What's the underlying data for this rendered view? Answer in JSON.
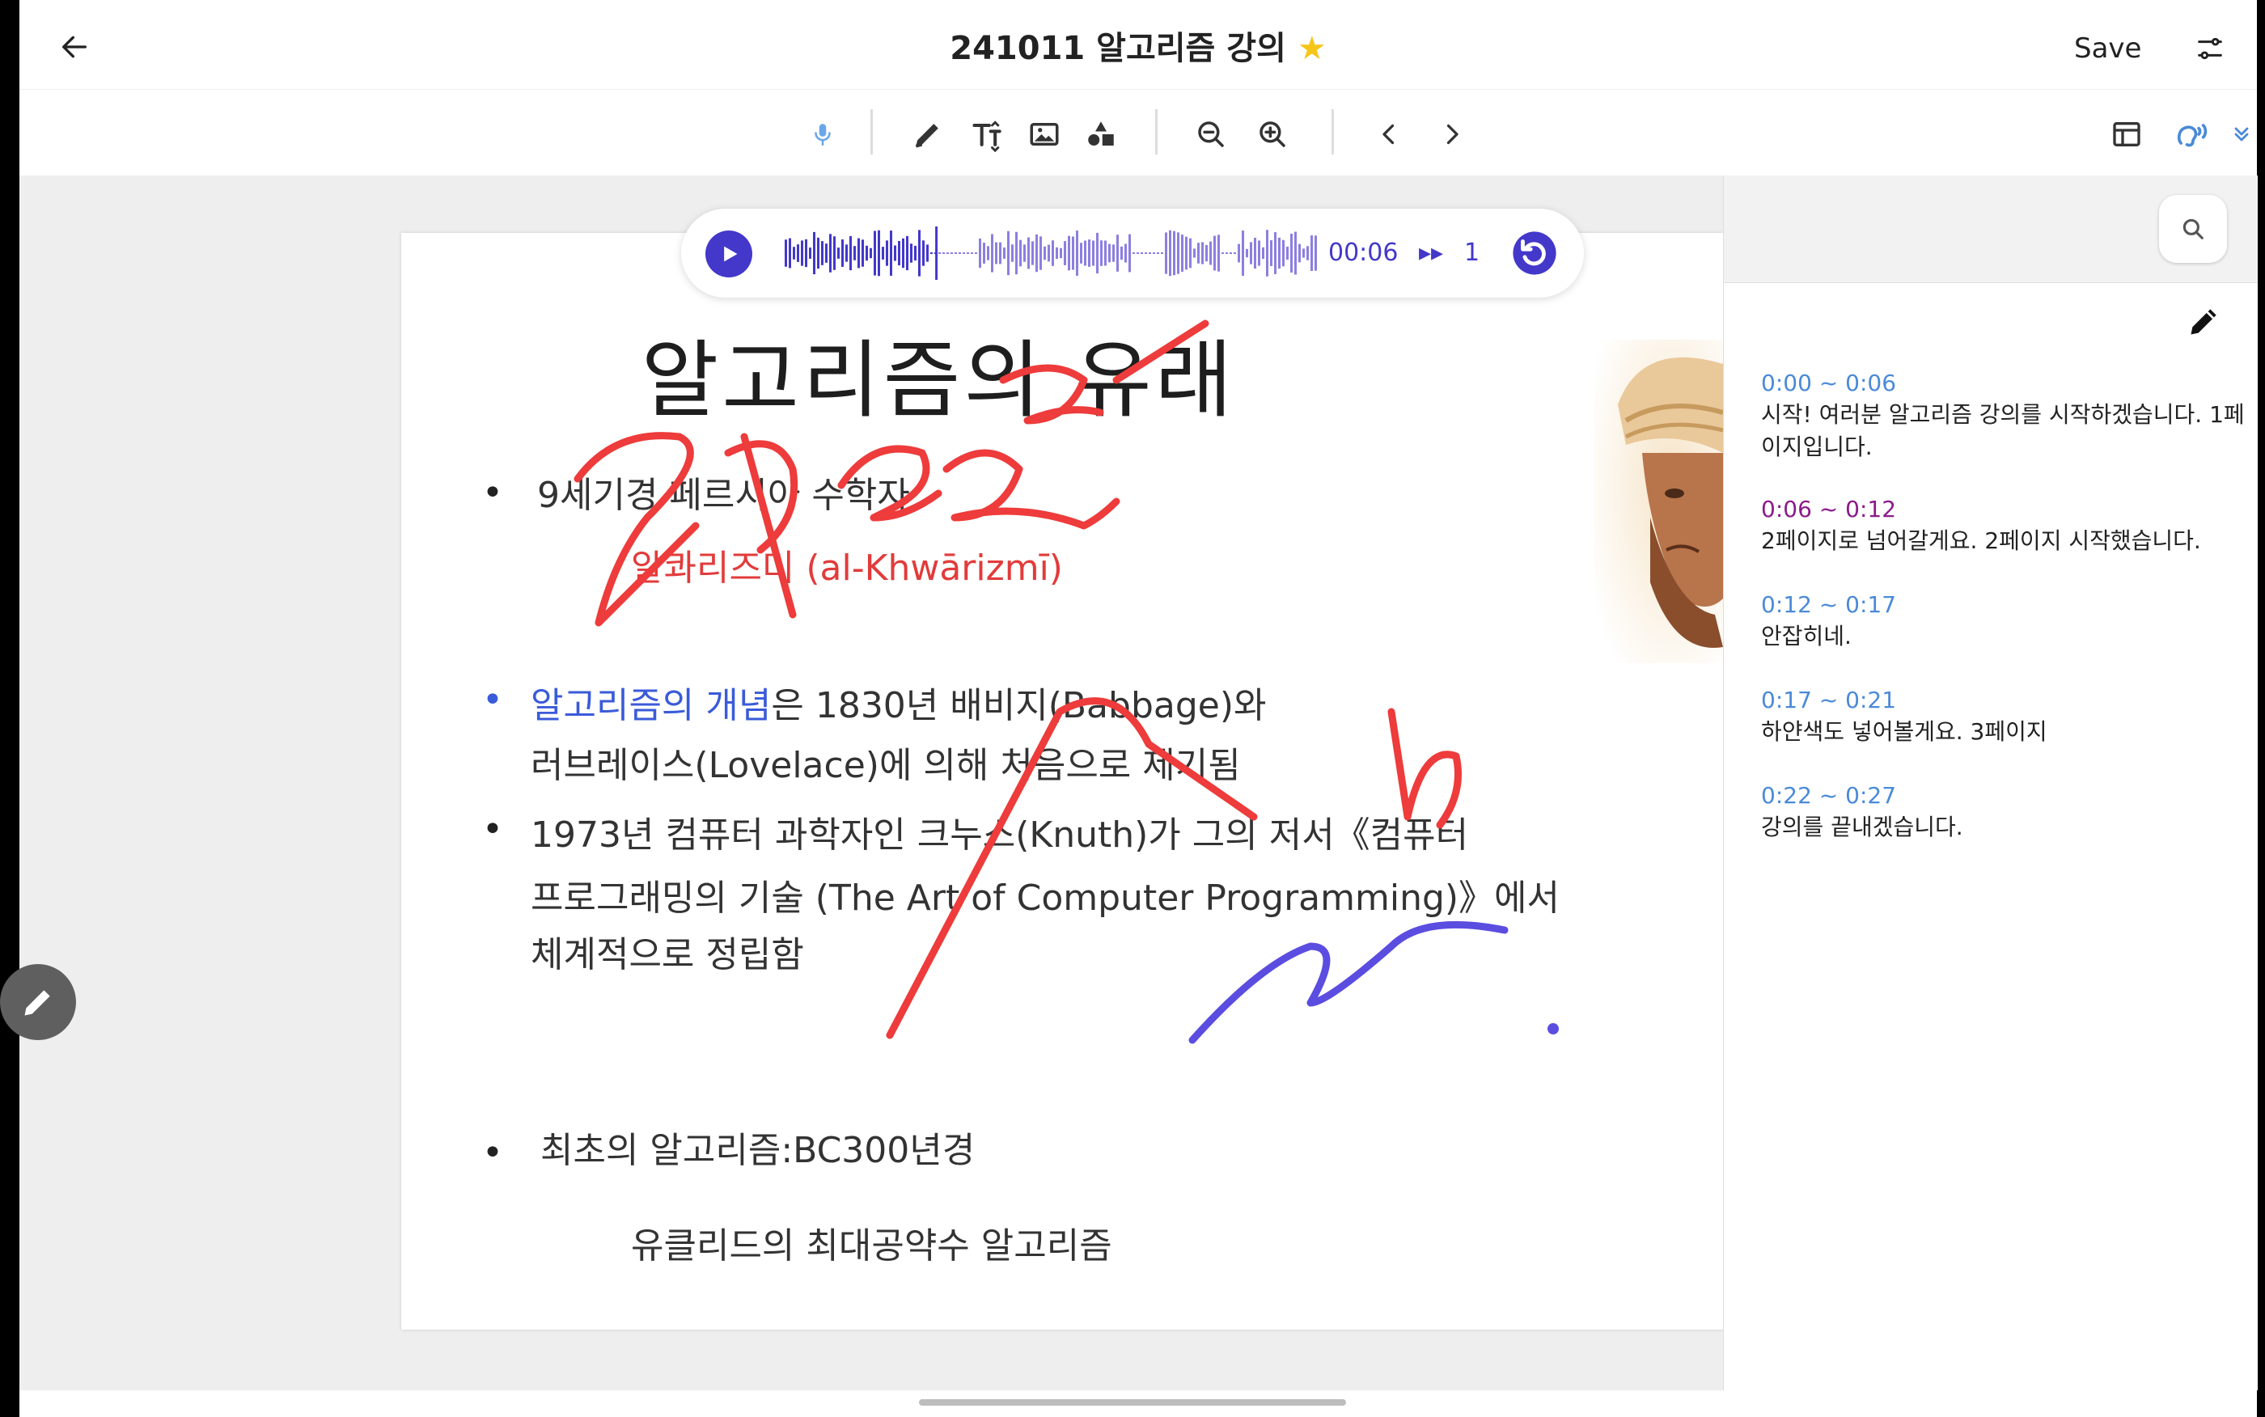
{
  "header": {
    "title": "241011 알고리즘 강의",
    "save_label": "Save"
  },
  "toolbar": {
    "items": [
      "mic-icon",
      "pen-icon",
      "text-size-icon",
      "image-icon",
      "shapes-icon",
      "zoom-out-icon",
      "zoom-in-icon",
      "prev-page-icon",
      "next-page-icon",
      "layout-icon",
      "speech-icon",
      "expand-icon"
    ]
  },
  "player": {
    "time": "00:06",
    "speed": "1",
    "progress": 0.25
  },
  "slide": {
    "title": "알고리즘의 유래",
    "b1_line1": "9세기경 페르시아 수학자",
    "b1_line2_ko": "알콰리즈미 ",
    "b1_line2_en": "(al-Khwārizmī)",
    "b2_blue": "알고리즘의 개념",
    "b2_rest": "은 1830년 배비지(Babbage)와",
    "b2_line2": "러브레이스(Lovelace)에 의해 처음으로 제기됨",
    "b3_line1": "1973년 컴퓨터 과학자인 크누스(Knuth)가 그의 저서《컴퓨터",
    "b3_line2": "프로그래밍의 기술 (The Art of Computer Programming)》에서",
    "b3_line3": "체계적으로 정립함",
    "b4_line1": "최초의 알고리즘:BC300년경",
    "b4_line2": "유클리드의 최대공약수 알고리즘"
  },
  "transcript": [
    {
      "time": "0:00 ~ 0:06",
      "text": "시작! 여러분 알고리즘 강의를 시작하겠습니다. 1페이지입니다."
    },
    {
      "time": "0:06 ~ 0:12",
      "text": "2페이지로 넘어갈게요. 2페이지 시작했습니다."
    },
    {
      "time": "0:12 ~ 0:17",
      "text": "안잡히네."
    },
    {
      "time": "0:17 ~ 0:21",
      "text": "하얀색도 넣어볼게요. 3페이지"
    },
    {
      "time": "0:22 ~ 0:27",
      "text": "강의를 끝내겠습니다."
    }
  ],
  "colors": {
    "accent": "#4338ca",
    "time_blue": "#4a8ad8",
    "time_active": "#8b1a8b",
    "ink_red": "#ee3b3b",
    "ink_purple": "#5b4de0",
    "star": "#f5c518"
  }
}
